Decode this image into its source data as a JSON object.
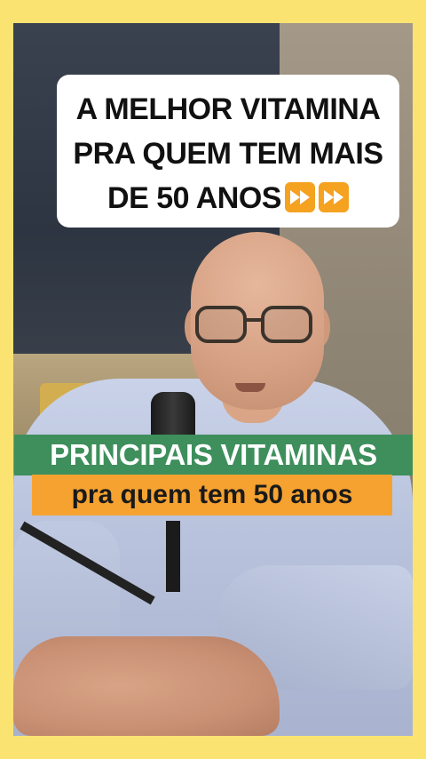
{
  "title": {
    "line1": "A MELHOR VITAMINA",
    "line2": "PRA QUEM TEM MAIS",
    "line3": "DE 50 ANOS",
    "icon": "fast-forward-icon"
  },
  "captions": {
    "headline": "PRINCIPAIS VITAMINAS",
    "subline": "pra quem tem 50 anos"
  },
  "colors": {
    "frame": "#fbe372",
    "headline_bg": "#3e8f5c",
    "subline_bg": "#f5a231",
    "icon_bg": "#f4a21f"
  }
}
